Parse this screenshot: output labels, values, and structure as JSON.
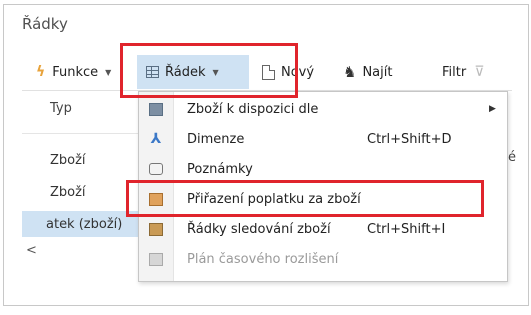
{
  "section": {
    "title": "Řádky"
  },
  "toolbar": {
    "funkce_label": "Funkce",
    "radek_label": "Řádek",
    "novy_label": "Nový",
    "najit_label": "Najít",
    "filtr_label": "Filtr"
  },
  "table": {
    "column_header": "Typ",
    "rows": [
      "Zboží",
      "Zboží",
      "atek (zboží)"
    ],
    "right_fragment": "é",
    "scroll_left": "<"
  },
  "menu": {
    "items": [
      {
        "label": "Zboží k dispozici dle",
        "shortcut": "",
        "submenu": true,
        "enabled": true,
        "icon": "stock-icon"
      },
      {
        "label": "Dimenze",
        "shortcut": "Ctrl+Shift+D",
        "submenu": false,
        "enabled": true,
        "icon": "dimension-icon"
      },
      {
        "label": "Poznámky",
        "shortcut": "",
        "submenu": false,
        "enabled": true,
        "icon": "note-icon"
      },
      {
        "label": "Přiřazení poplatku za zboží",
        "shortcut": "",
        "submenu": false,
        "enabled": true,
        "icon": "charge-assignment-icon"
      },
      {
        "label": "Řádky sledování zboží",
        "shortcut": "Ctrl+Shift+I",
        "submenu": false,
        "enabled": true,
        "icon": "item-tracking-icon"
      },
      {
        "label": "Plán časového rozlišení",
        "shortcut": "",
        "submenu": false,
        "enabled": false,
        "icon": "deferral-schedule-icon"
      }
    ]
  },
  "colors": {
    "highlight_red": "#e0242c",
    "selection_blue": "#cfe2f3",
    "funkce_icon": "#e8a33b"
  }
}
